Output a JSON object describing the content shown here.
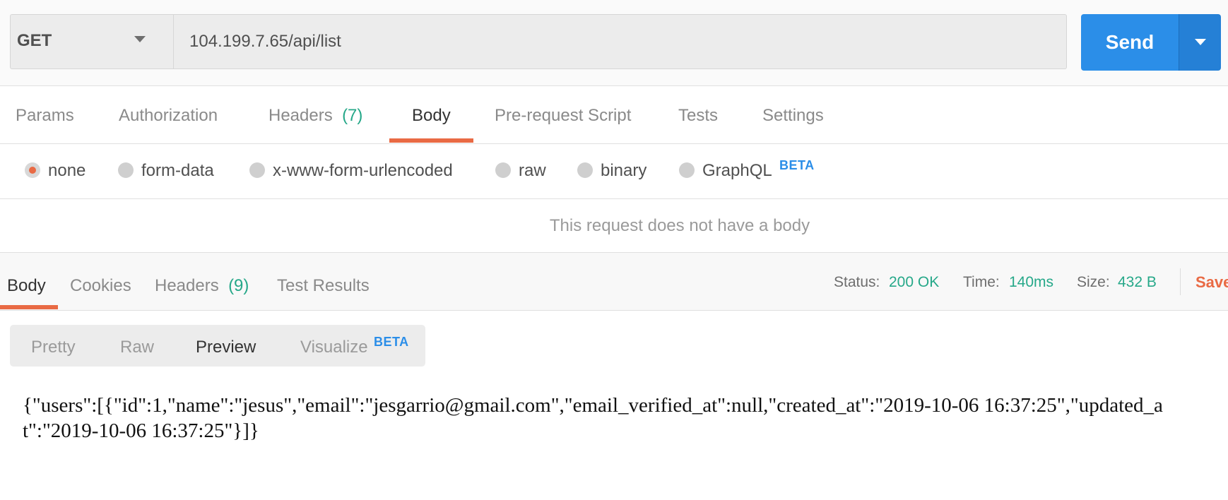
{
  "request": {
    "method": "GET",
    "url": "104.199.7.65/api/list",
    "send_label": "Send"
  },
  "request_tabs": [
    {
      "label": "Params"
    },
    {
      "label": "Authorization"
    },
    {
      "label": "Headers",
      "count": "(7)"
    },
    {
      "label": "Body",
      "active": true
    },
    {
      "label": "Pre-request Script"
    },
    {
      "label": "Tests"
    },
    {
      "label": "Settings"
    }
  ],
  "body_types": [
    {
      "label": "none",
      "selected": true
    },
    {
      "label": "form-data"
    },
    {
      "label": "x-www-form-urlencoded"
    },
    {
      "label": "raw"
    },
    {
      "label": "binary"
    },
    {
      "label": "GraphQL",
      "badge": "BETA"
    }
  ],
  "no_body_message": "This request does not have a body",
  "response_tabs": [
    {
      "label": "Body",
      "active": true
    },
    {
      "label": "Cookies"
    },
    {
      "label": "Headers",
      "count": "(9)"
    },
    {
      "label": "Test Results"
    }
  ],
  "response_meta": {
    "status_label": "Status:",
    "status_value": "200 OK",
    "time_label": "Time:",
    "time_value": "140ms",
    "size_label": "Size:",
    "size_value": "432 B",
    "save_label": "Save"
  },
  "view_modes": [
    {
      "label": "Pretty"
    },
    {
      "label": "Raw"
    },
    {
      "label": "Preview",
      "active": true
    },
    {
      "label": "Visualize",
      "badge": "BETA"
    }
  ],
  "response_body": "{\"users\":[{\"id\":1,\"name\":\"jesus\",\"email\":\"jesgarrio@gmail.com\",\"email_verified_at\":null,\"created_at\":\"2019-10-06 16:37:25\",\"updated_at\":\"2019-10-06 16:37:25\"}]}",
  "colors": {
    "accent_orange": "#e96a44",
    "send_blue": "#2b8ee8",
    "success_green": "#26a889"
  }
}
